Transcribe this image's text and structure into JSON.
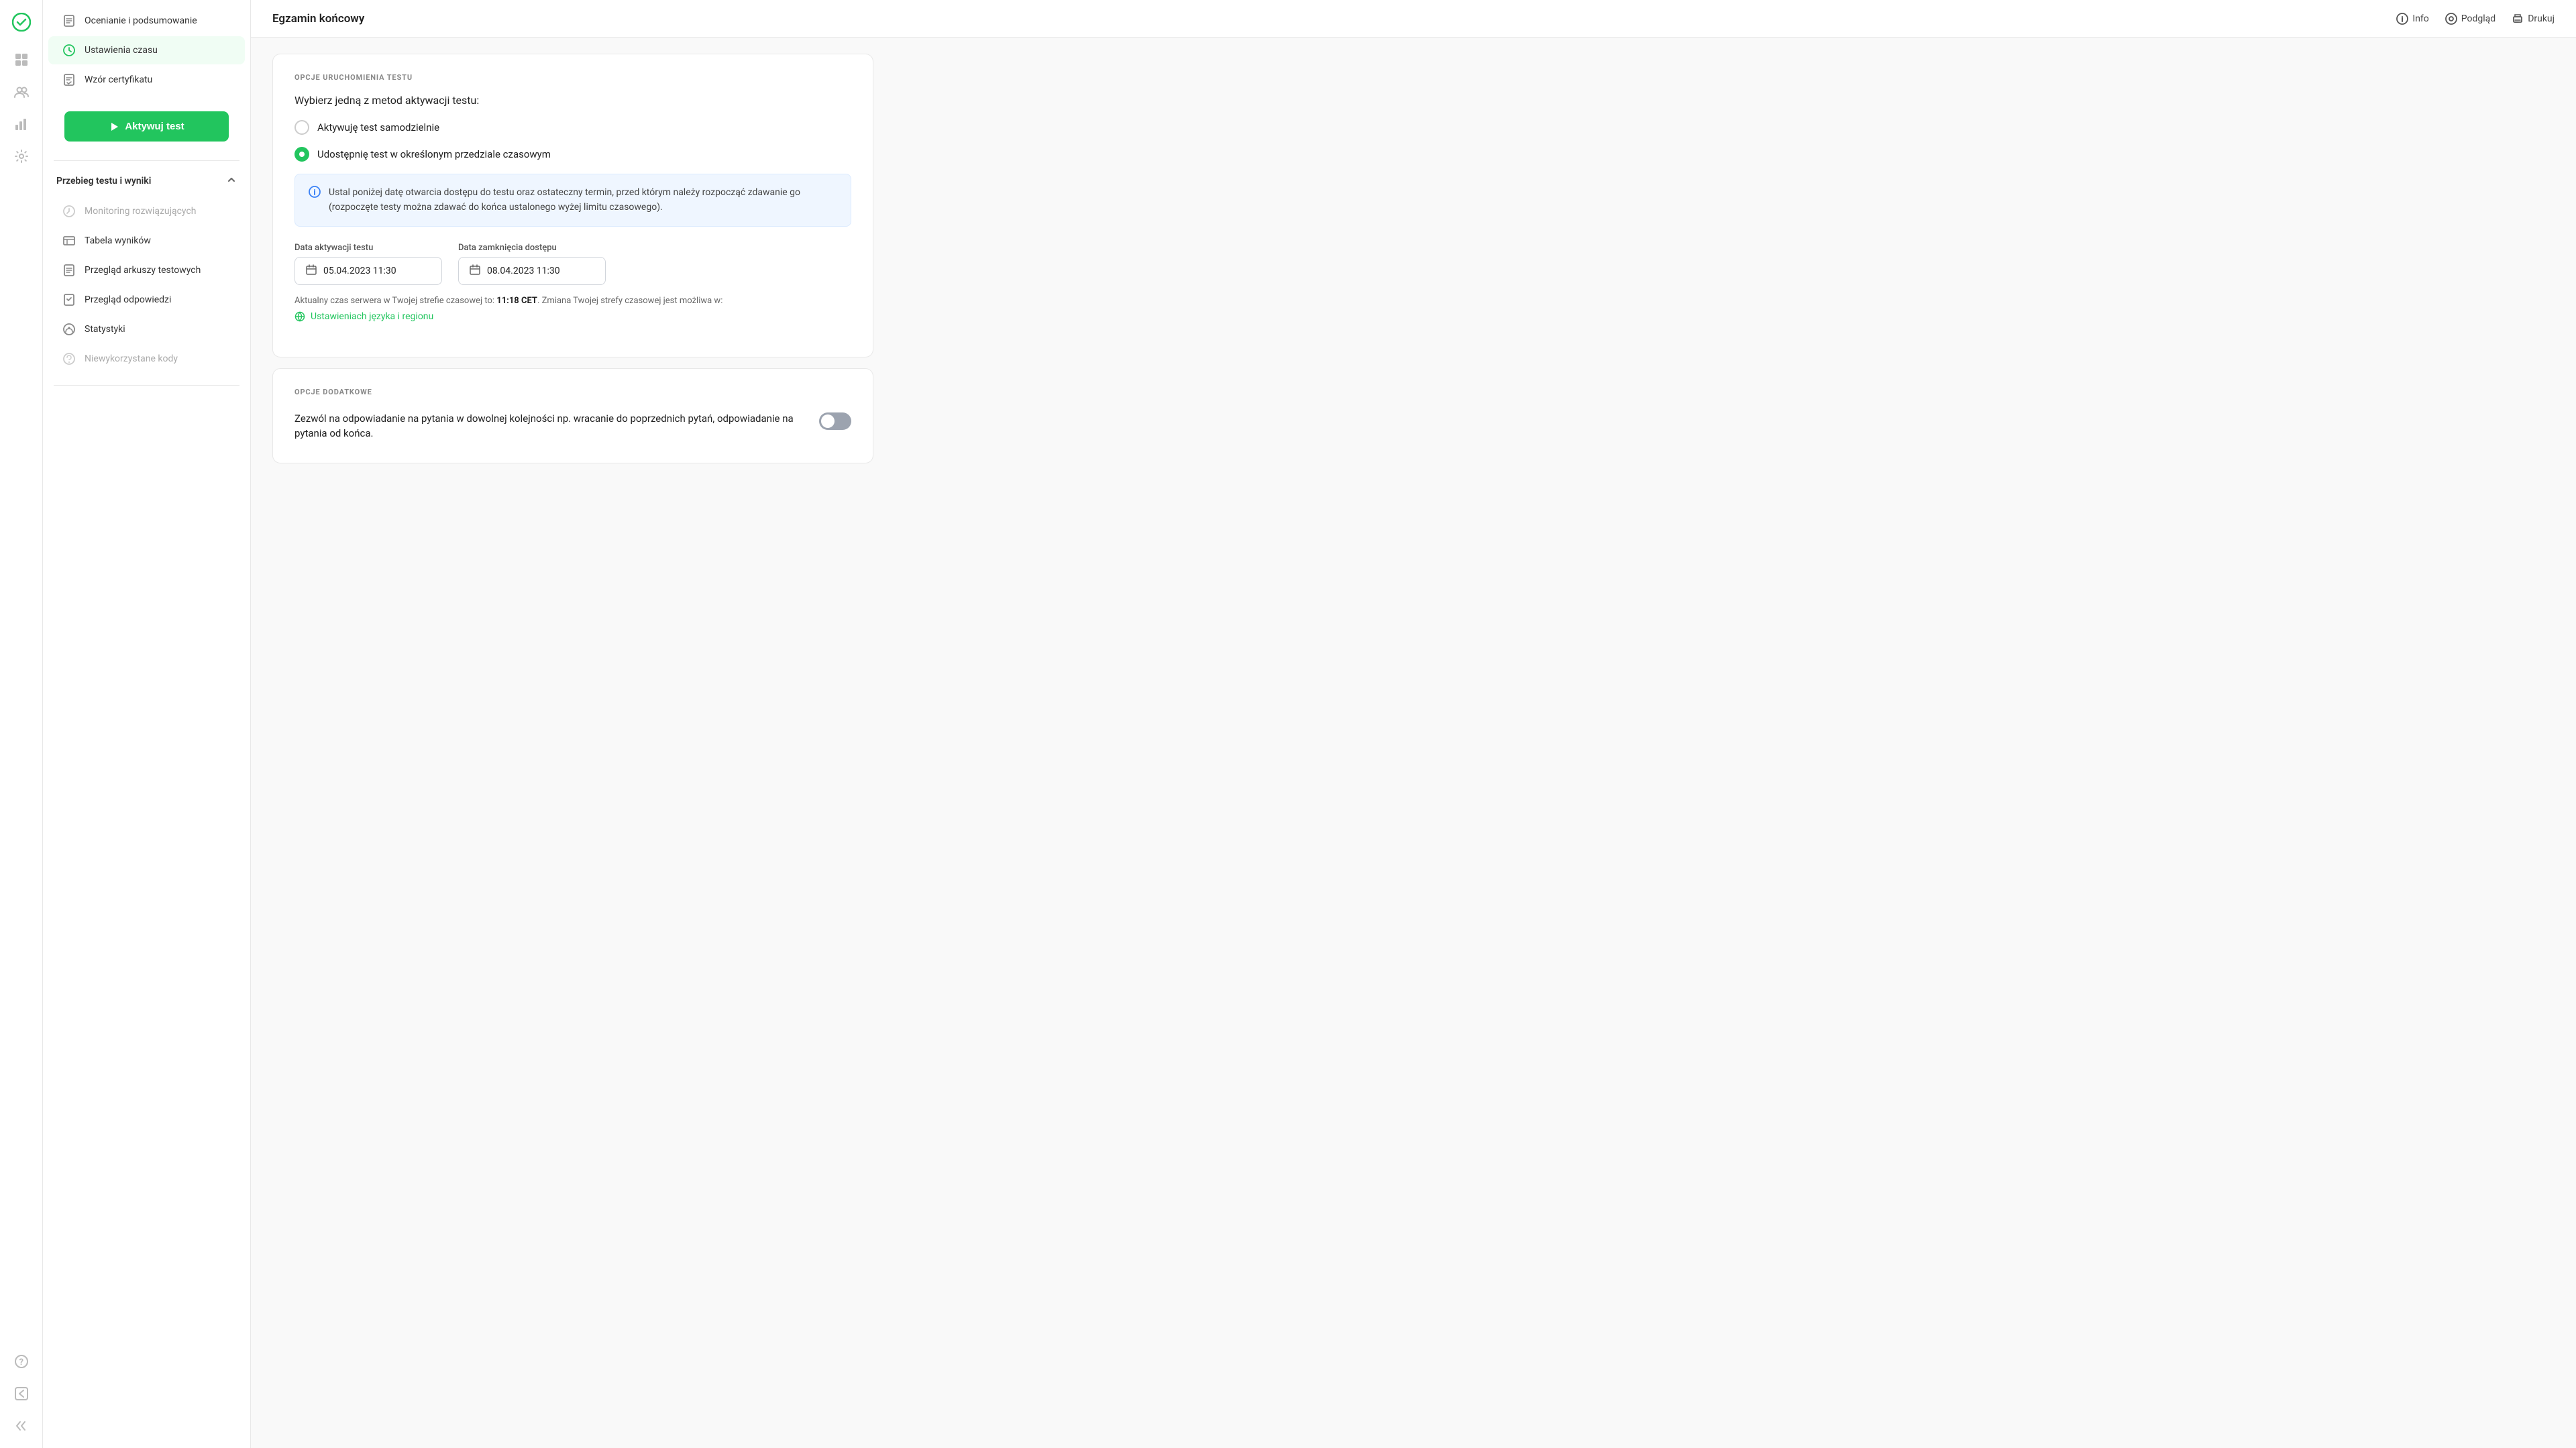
{
  "app": {
    "brand_icon": "✓",
    "title": "Egzamin końcowy"
  },
  "topbar": {
    "title": "Egzamin końcowy",
    "actions": [
      {
        "id": "info",
        "label": "Info",
        "icon": "ℹ"
      },
      {
        "id": "preview",
        "label": "Podgląd",
        "icon": "👁"
      },
      {
        "id": "print",
        "label": "Drukuj",
        "icon": "🖨"
      }
    ]
  },
  "icon_sidebar": {
    "top_icons": [
      {
        "id": "brand",
        "icon": "✓",
        "active": true,
        "brand": true
      },
      {
        "id": "dashboard",
        "icon": "⊞"
      },
      {
        "id": "users",
        "icon": "👥"
      },
      {
        "id": "analytics",
        "icon": "📊"
      },
      {
        "id": "settings",
        "icon": "⚙"
      }
    ],
    "bottom_icons": [
      {
        "id": "help",
        "icon": "?"
      },
      {
        "id": "back",
        "icon": "↩"
      },
      {
        "id": "collapse",
        "icon": "»"
      }
    ]
  },
  "nav_sidebar": {
    "items_top": [
      {
        "id": "ocenianie",
        "label": "Ocenianie i podsumowanie",
        "icon": "📋",
        "active": false
      },
      {
        "id": "ustawienia_czasu",
        "label": "Ustawienia czasu",
        "icon": "⏱",
        "active": true
      }
    ],
    "activate_button": "Aktywuj test",
    "section_progress": {
      "title": "Przebieg testu i wyniki",
      "items": [
        {
          "id": "monitoring",
          "label": "Monitoring rozwiązujących",
          "icon": "⟳",
          "disabled": true
        },
        {
          "id": "tabela",
          "label": "Tabela wyników",
          "icon": "📊",
          "disabled": false
        },
        {
          "id": "przeglad_arkuszy",
          "label": "Przegląd arkuszy testowych",
          "icon": "📄",
          "disabled": false
        },
        {
          "id": "przeglad_odpowiedzi",
          "label": "Przegląd odpowiedzi",
          "icon": "✔",
          "disabled": false
        },
        {
          "id": "statystyki",
          "label": "Statystyki",
          "icon": "📈",
          "disabled": false
        },
        {
          "id": "kody",
          "label": "Niewykorzystane kody",
          "icon": "🔑",
          "disabled": true
        }
      ]
    },
    "wzor_certyfikatu": {
      "id": "wzor",
      "label": "Wzór certyfikatu",
      "icon": "📜"
    }
  },
  "main": {
    "section1": {
      "label": "OPCJE URUCHOMIENIA TESTU",
      "question": "Wybierz jedną z metod aktywacji testu:",
      "options": [
        {
          "id": "samodzielnie",
          "label": "Aktywuję test samodzielnie",
          "selected": false
        },
        {
          "id": "przedzial",
          "label": "Udostępnię test w określonym przedziale czasowym",
          "selected": true
        }
      ],
      "info_box": "Ustal poniżej datę otwarcia dostępu do testu oraz ostateczny termin, przed którym należy rozpocząć zdawanie go (rozpoczęte testy można zdawać do końca ustalonego wyżej limitu czasowego).",
      "date_activation_label": "Data aktywacji testu",
      "date_activation_value": "05.04.2023 11:30",
      "date_close_label": "Data zamknięcia dostępu",
      "date_close_value": "08.04.2023 11:30",
      "server_time_prefix": "Aktualny czas serwera w Twojej strefie czasowej to: ",
      "server_time_value": "11:18 CET",
      "server_time_suffix": ". Zmiana Twojej strefy czasowej jest możliwa w:",
      "settings_link": "Ustawieniach języka i regionu"
    },
    "section2": {
      "label": "OPCJE DODATKOWE",
      "toggle_label": "Zezwól na odpowiadanie na pytania w dowolnej kolejności np. wracanie do poprzednich pytań, odpowiadanie na pytania od końca.",
      "toggle_on": false
    }
  }
}
